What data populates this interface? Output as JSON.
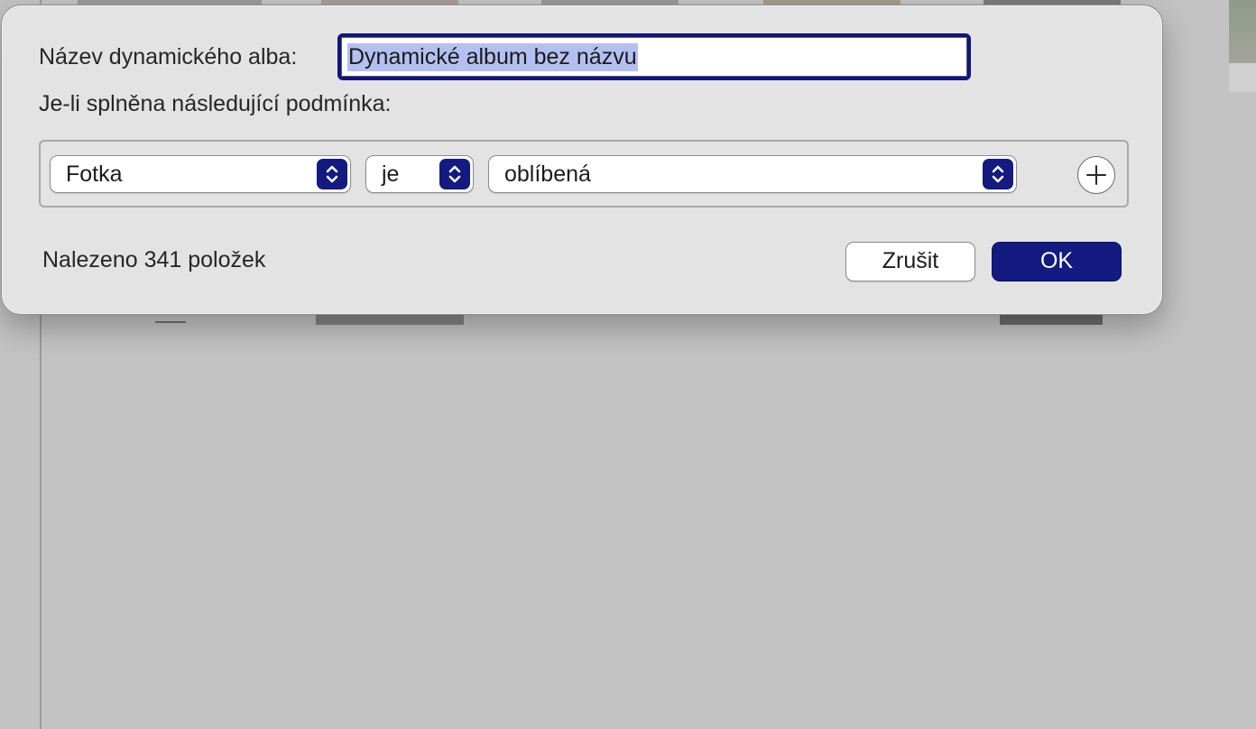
{
  "dialog": {
    "name_label": "Název dynamického alba:",
    "name_value": "Dynamické album bez názvu",
    "condition_label": "Je-li splněna následující podmínka:",
    "rule": {
      "field": "Fotka",
      "operator": "je",
      "value": "oblíbená",
      "add_icon": "plus-icon",
      "popup_icon": "chevron-up-down-icon"
    },
    "found_text": "Nalezeno 341 položek",
    "cancel_label": "Zrušit",
    "ok_label": "OK"
  },
  "colors": {
    "accent": "#131a80",
    "selection": "#b4c0f0",
    "dialog_bg": "#e3e3e3",
    "backdrop": "#c3c3c3"
  }
}
